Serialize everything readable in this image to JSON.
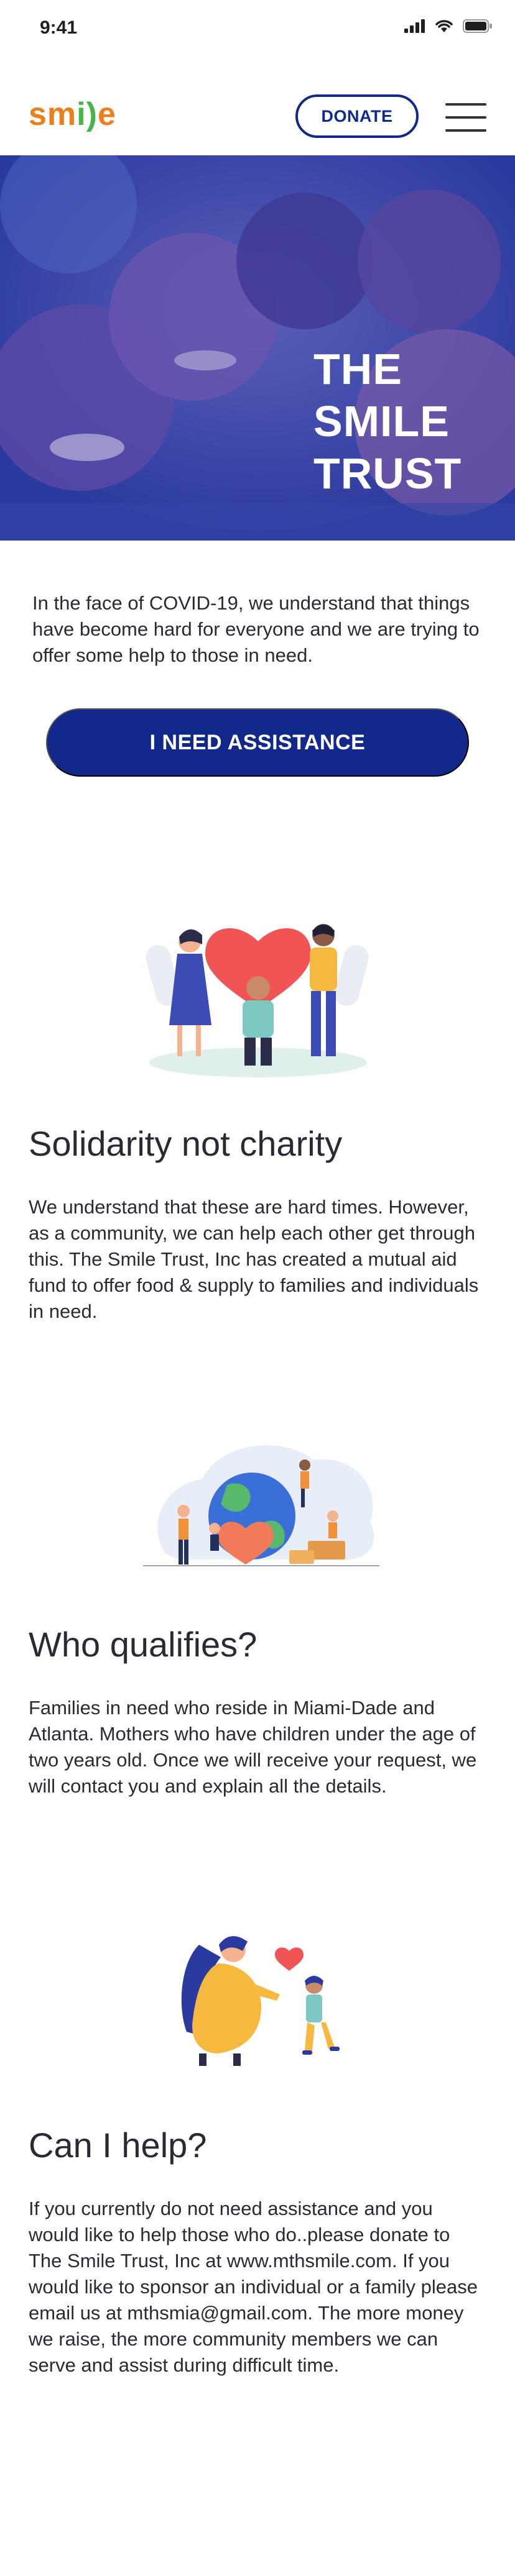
{
  "status_bar": {
    "time": "9:41",
    "icons": [
      "signal-icon",
      "wifi-icon",
      "battery-icon"
    ]
  },
  "header": {
    "logo_text": "smile",
    "donate_label": "DONATE",
    "menu_icon": "hamburger-menu-icon"
  },
  "hero": {
    "title_lines": [
      "THE",
      "SMILE",
      "TRUST"
    ]
  },
  "intro": {
    "text": "In the face of COVID-19, we understand that things have become hard for everyone and we are trying to offer some help to those in need."
  },
  "assist_button": {
    "label": "I NEED ASSISTANCE"
  },
  "sections": [
    {
      "title": "Solidarity not charity",
      "body": "We understand that these are hard times. However, as a community, we can help each other get through this. The Smile Trust, Inc has created a mutual aid fund to offer food & supply  to families and individuals in need."
    },
    {
      "title": "Who qualifies?",
      "body": "Families in need who reside in Miami-Dade and Atlanta. Mothers who have children under the age of two years old. Once we will receive your request, we will contact you and explain all the details."
    },
    {
      "title": "Can I help?",
      "body": "If you currently do not need assistance and you would like to help those who do..please donate to The Smile Trust, Inc at www.mthsmile.com. If you would like to sponsor an individual or a family please email us at mthsmia@gmail.com. The more money we raise, the more community members we can serve and assist during difficult time."
    }
  ],
  "colors": {
    "brand_blue": "#12288a",
    "logo_orange": "#ef7d1a",
    "logo_green": "#44b649",
    "heart_red": "#f05454",
    "hero_overlay": "#2e3fa8"
  }
}
